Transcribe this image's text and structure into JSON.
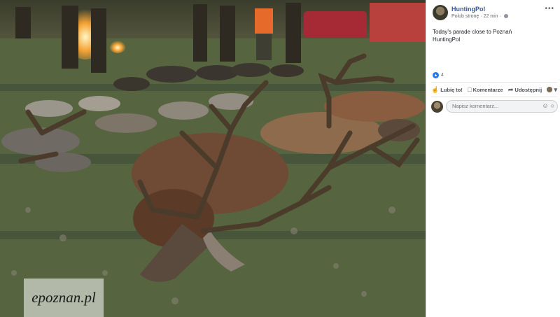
{
  "post": {
    "author": "HuntingPol",
    "like_page_link": "Polub stronę",
    "timestamp": "22 min",
    "menu_glyph": "•••",
    "text_lines": [
      "Today's parade close to Poznań",
      "HuntingPol"
    ],
    "reaction_count": "4"
  },
  "actions": {
    "like": "Lubię to!",
    "comment": "Komentarze",
    "share": "Udostępnij"
  },
  "comment_box": {
    "placeholder": "Napisz komentarz..."
  },
  "photo": {
    "watermark": "epoznan.pl"
  },
  "colors": {
    "link": "#385898",
    "reaction": "#2078f4",
    "grass": "#4d5a3f"
  }
}
